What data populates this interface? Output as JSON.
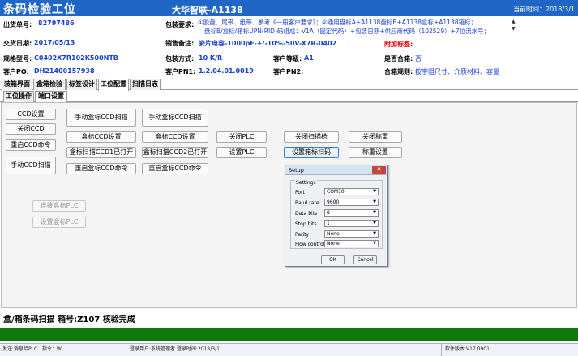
{
  "title": {
    "app": "条码检验工位",
    "center": "大华智联-A1138",
    "time": "当前时间：2018/3/1"
  },
  "info": {
    "order_label": "出货单号:",
    "order_value": "82797486",
    "pack_req_label": "包装要求:",
    "pack_req_line1": "①胶盘、尾带、纸带、参考《一般客户要求》；②通用盘标A+A1138盘标B+A1138盒标+A1138箱标；",
    "pack_req_line2": "盘标B/盒标/箱标UPN(RID)码组成：V1A（固定代码）+包装日期+供应商代码（102529）+7位流水号；",
    "scroll_up": "▲",
    "scroll_down": "▼",
    "deal_date_label": "交货日期:",
    "deal_date_value": "2017/05/13",
    "sales_note_label": "销售备注:",
    "sales_note_value": "瓷片电容-1000pF-+/-10%-50V-X7R-0402",
    "attach_label": "附加标签:",
    "attach_value": "",
    "spec_label": "规格型号:",
    "spec_value": "C0402X7R102K500NTB",
    "pack_method_label": "包装方式:",
    "pack_method_value": "10 K/R",
    "cust_level_label": "客户等级:",
    "cust_level_value": "A1",
    "combine_label": "是否合箱:",
    "combine_value": "否",
    "cust_po_label": "客户PO:",
    "cust_po_value": "DH21400157938",
    "cust_pn1_label": "客户PN1:",
    "cust_pn1_value": "1.2.04.01.0019",
    "cust_pn2_label": "客户PN2:",
    "cust_pn2_value": "",
    "rule_label": "合箱规则:",
    "rule_value": "按字阻尺寸、介质材料、容量"
  },
  "tabs_main": [
    "装箱界面",
    "盒箱检验",
    "标签设计",
    "工位配置",
    "扫描日志"
  ],
  "tabs_sub": [
    "工位操作",
    "端口设置"
  ],
  "buttons": {
    "ccd_settings": "CCD设置",
    "close_ccd": "关闭CCD",
    "restart_ccd": "重启CCD命令",
    "manual_ccd": "手动CCD扫描",
    "manual_box_ccd1": "手动盒标CCD扫描",
    "box_ccd_settings1": "盒标CCD设置",
    "box_ccd1_opened": "盒标扫描CCD1已打开",
    "restart_box_ccd1": "重启盒标CCD命令",
    "manual_box_ccd2": "手动盒标CCD扫描",
    "box_ccd_settings2": "盒标CCD设置",
    "box_ccd2_opened": "盒标扫描CCD2已打开",
    "restart_box_ccd2": "重启盒标CCD命令",
    "close_plc": "关闭PLC",
    "set_plc": "设置PLC",
    "close_scanner": "关闭扫描枪",
    "set_case_scanner": "设置箱标扫码",
    "close_scale": "关闭称重",
    "scale_settings": "称重设置",
    "connect_box_plc": "连接盒标PLC",
    "set_box_plc": "设置盒标PLC"
  },
  "dialog": {
    "title": "Setup",
    "close": "✕",
    "group": "Settings",
    "rows": [
      {
        "label": "Port",
        "value": "COM10"
      },
      {
        "label": "Baud rate",
        "value": "9600"
      },
      {
        "label": "Data bits",
        "value": "8"
      },
      {
        "label": "Stop bits",
        "value": "1"
      },
      {
        "label": "Parity",
        "value": "None"
      },
      {
        "label": "Flow control",
        "value": "None"
      }
    ],
    "ok": "OK",
    "cancel": "Cancel"
  },
  "status_text": "盒/箱条码扫描  箱号:Z107 核验完成",
  "bottom": {
    "seg1": "发送:消息给PLC...指令：W",
    "seg2": "登录用户:系统管理者 登录时间:2018/3/1",
    "seg3": "软件版本:V17.0901"
  }
}
